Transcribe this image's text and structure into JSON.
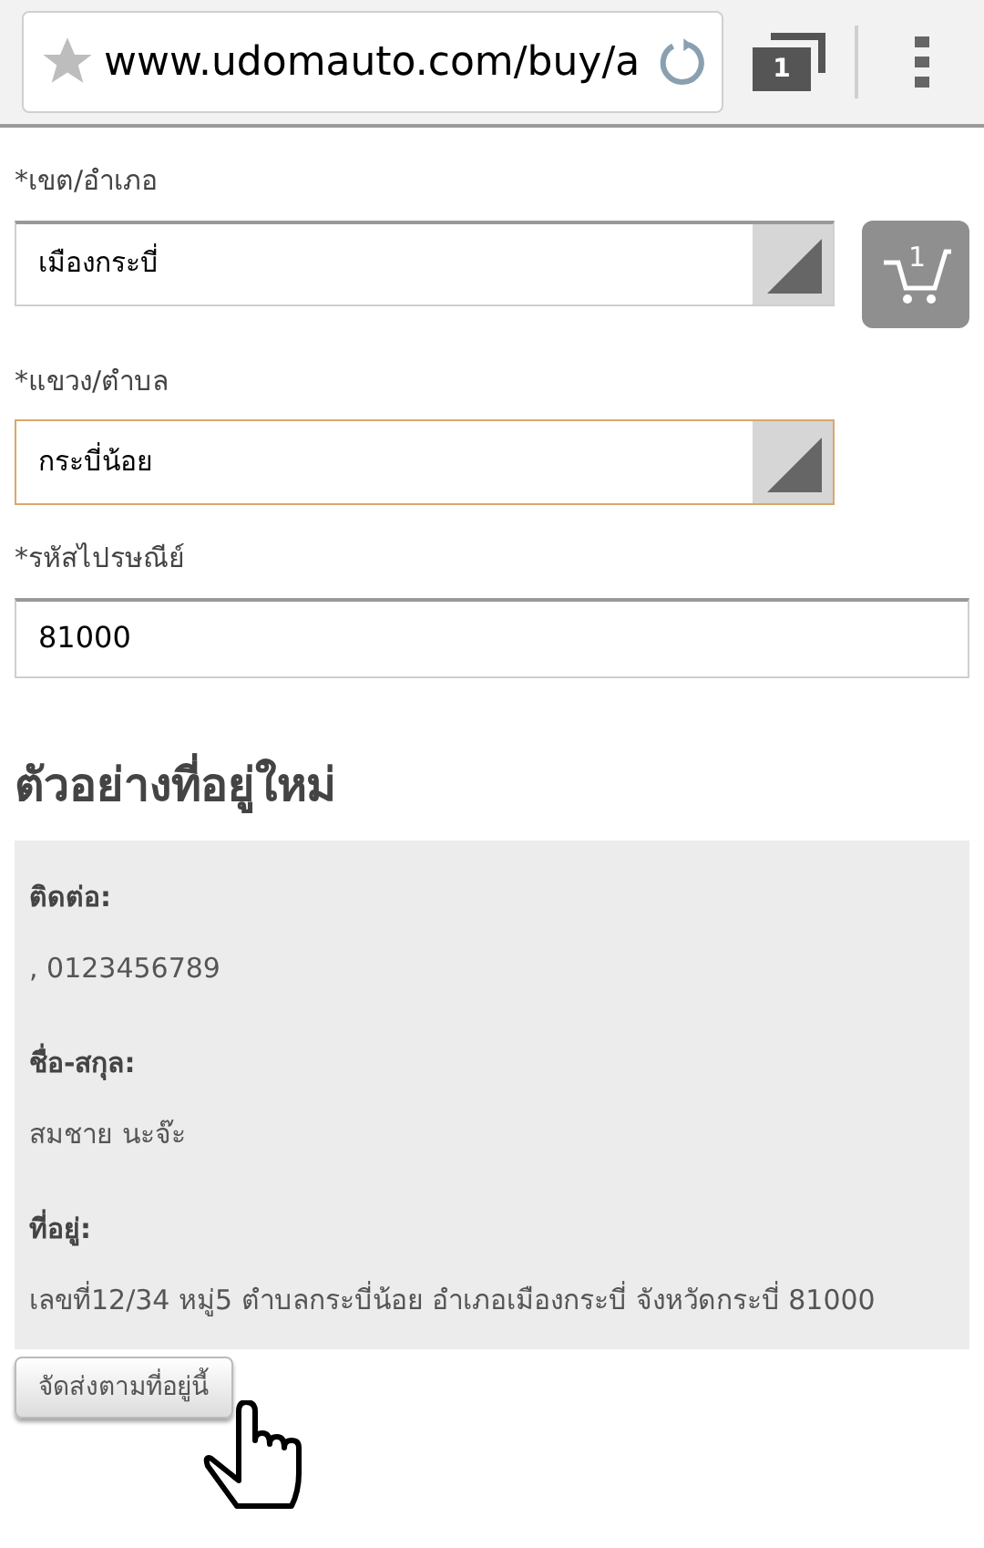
{
  "browser": {
    "url": "www.udomauto.com/buy/a",
    "tab_count": "1"
  },
  "fields": [
    {
      "kind": "select",
      "label": "*เขต/อำเภอ",
      "value": "เมืองกระบี่",
      "focused": false
    },
    {
      "kind": "select",
      "label": "*แขวง/ตำบล",
      "value": "กระบี่น้อย",
      "focused": true
    },
    {
      "kind": "input",
      "label": "*รหัสไปรษณีย์",
      "value": "81000",
      "focused": false
    }
  ],
  "cart": {
    "count": "1"
  },
  "preview": {
    "title": "ตัวอย่างที่อยู่ใหม่",
    "sections": [
      {
        "label": "ติดต่อ:",
        "value": ", 0123456789"
      },
      {
        "label": "ชื่อ-สกุล:",
        "value": "สมชาย นะจ๊ะ"
      },
      {
        "label": "ที่อยู่:",
        "value": "เลขที่12/34 หมู่5 ตำบลกระบี่น้อย อำเภอเมืองกระบี่ จังหวัดกระบี่ 81000"
      }
    ]
  },
  "ship_button": "จัดส่งตามที่อยู่นี้"
}
